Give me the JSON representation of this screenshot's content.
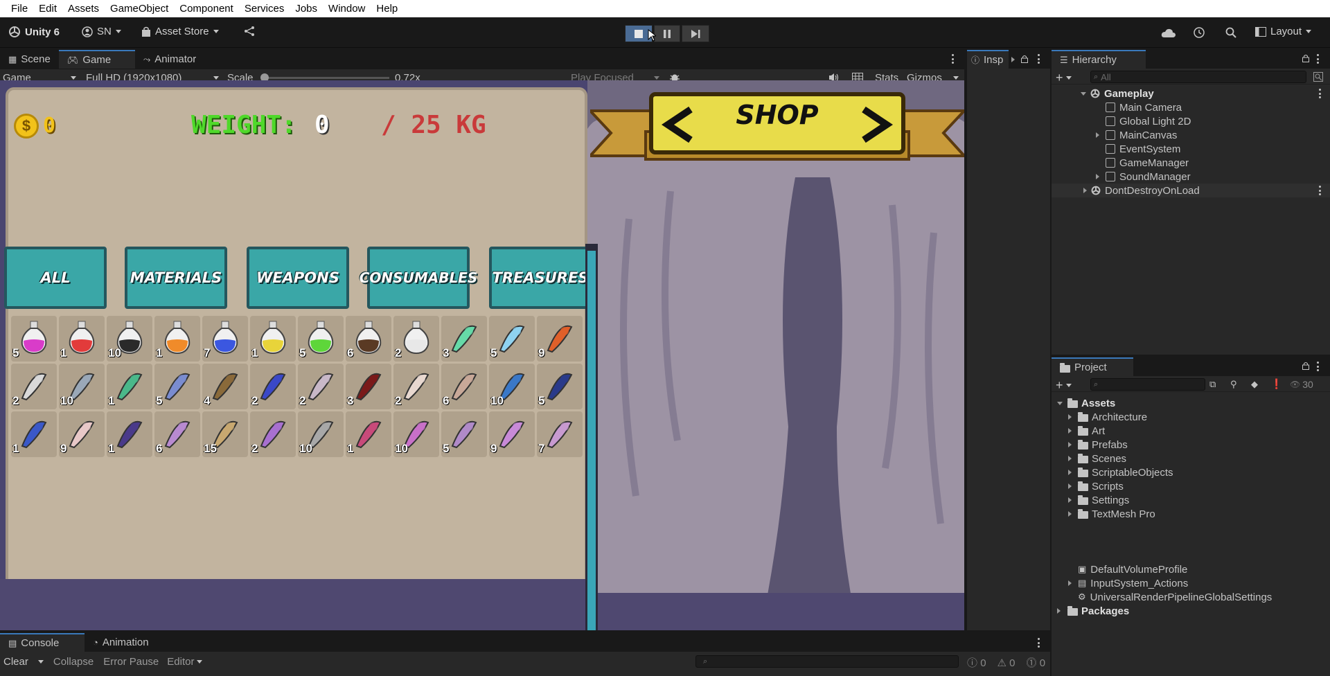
{
  "menu": [
    "File",
    "Edit",
    "Assets",
    "GameObject",
    "Component",
    "Services",
    "Jobs",
    "Window",
    "Help"
  ],
  "toolbar": {
    "unity_label": "Unity 6",
    "account": "SN",
    "asset_store": "Asset Store",
    "layout": "Layout"
  },
  "game_tabs": [
    "Scene",
    "Game",
    "Animator"
  ],
  "inspector_tab": "Insp",
  "game_bar": {
    "display": "Game",
    "resolution": "Full HD (1920x1080)",
    "scale_label": "Scale",
    "scale_value": "0.72x",
    "play_focused": "Play Focused",
    "stats": "Stats",
    "gizmos": "Gizmos"
  },
  "game": {
    "coins": "0",
    "weight_label": "WEIGHT:",
    "weight_value": "0",
    "weight_max": "/ 25 KG",
    "shop_title": "SHOP",
    "categories": [
      "ALL",
      "MATERIALS",
      "WEAPONS",
      "CONSUMABLES",
      "TREASURES"
    ],
    "row1": [
      {
        "n": "5",
        "c": "#d93cc9"
      },
      {
        "n": "1",
        "c": "#e23b3b"
      },
      {
        "n": "10",
        "c": "#2a2a2a"
      },
      {
        "n": "1",
        "c": "#f08b2a"
      },
      {
        "n": "7",
        "c": "#3b57e0"
      },
      {
        "n": "1",
        "c": "#e8d43a"
      },
      {
        "n": "5",
        "c": "#5ed63a"
      },
      {
        "n": "6",
        "c": "#5a3a24"
      },
      {
        "n": "2",
        "c": "#e8e8e8"
      },
      {
        "n": "3",
        "c": "#66d9a8"
      },
      {
        "n": "5",
        "c": "#8fd2f0"
      },
      {
        "n": "9",
        "c": "#e0602a"
      }
    ],
    "row2": [
      {
        "n": "2",
        "c": "#d9d9d9"
      },
      {
        "n": "10",
        "c": "#9aa8b8"
      },
      {
        "n": "1",
        "c": "#4ab88a"
      },
      {
        "n": "5",
        "c": "#7a8cd0"
      },
      {
        "n": "4",
        "c": "#8a6a3a"
      },
      {
        "n": "2",
        "c": "#3a48c8"
      },
      {
        "n": "2",
        "c": "#c8b8c8"
      },
      {
        "n": "3",
        "c": "#7a1a1a"
      },
      {
        "n": "2",
        "c": "#e8d8d0"
      },
      {
        "n": "6",
        "c": "#c8a898"
      },
      {
        "n": "10",
        "c": "#3a78c8"
      },
      {
        "n": "5",
        "c": "#2a3a8a"
      }
    ],
    "row3": [
      {
        "n": "1",
        "c": "#3a58c8"
      },
      {
        "n": "9",
        "c": "#e8c8c8"
      },
      {
        "n": "1",
        "c": "#4a3a8a"
      },
      {
        "n": "6",
        "c": "#b88ad0"
      },
      {
        "n": "15",
        "c": "#c8a870"
      },
      {
        "n": "2",
        "c": "#a870d0"
      },
      {
        "n": "10",
        "c": "#a8a8a8"
      },
      {
        "n": "1",
        "c": "#c84a7a"
      },
      {
        "n": "10",
        "c": "#c870c8"
      },
      {
        "n": "5",
        "c": "#b08ac8"
      },
      {
        "n": "9",
        "c": "#c88ad8"
      },
      {
        "n": "7",
        "c": "#c89ad0"
      }
    ]
  },
  "hierarchy": {
    "title": "Hierarchy",
    "search_placeholder": "All",
    "scene": "Gameplay",
    "items": [
      "Main Camera",
      "Global Light 2D",
      "MainCanvas",
      "EventSystem",
      "GameManager",
      "SoundManager"
    ],
    "dontdestroy": "DontDestroyOnLoad"
  },
  "project": {
    "title": "Project",
    "eye_count": "30",
    "root": "Assets",
    "folders": [
      "Architecture",
      "Art",
      "Prefabs",
      "Scenes",
      "ScriptableObjects",
      "Scripts",
      "Settings",
      "TextMesh Pro"
    ],
    "files": [
      "DefaultVolumeProfile",
      "InputSystem_Actions",
      "UniversalRenderPipelineGlobalSettings"
    ],
    "packages": "Packages"
  },
  "console": {
    "tabs": [
      "Console",
      "Animation"
    ],
    "clear": "Clear",
    "collapse": "Collapse",
    "error_pause": "Error Pause",
    "editor": "Editor",
    "count_log": "0",
    "count_warn": "0",
    "count_err": "0"
  }
}
